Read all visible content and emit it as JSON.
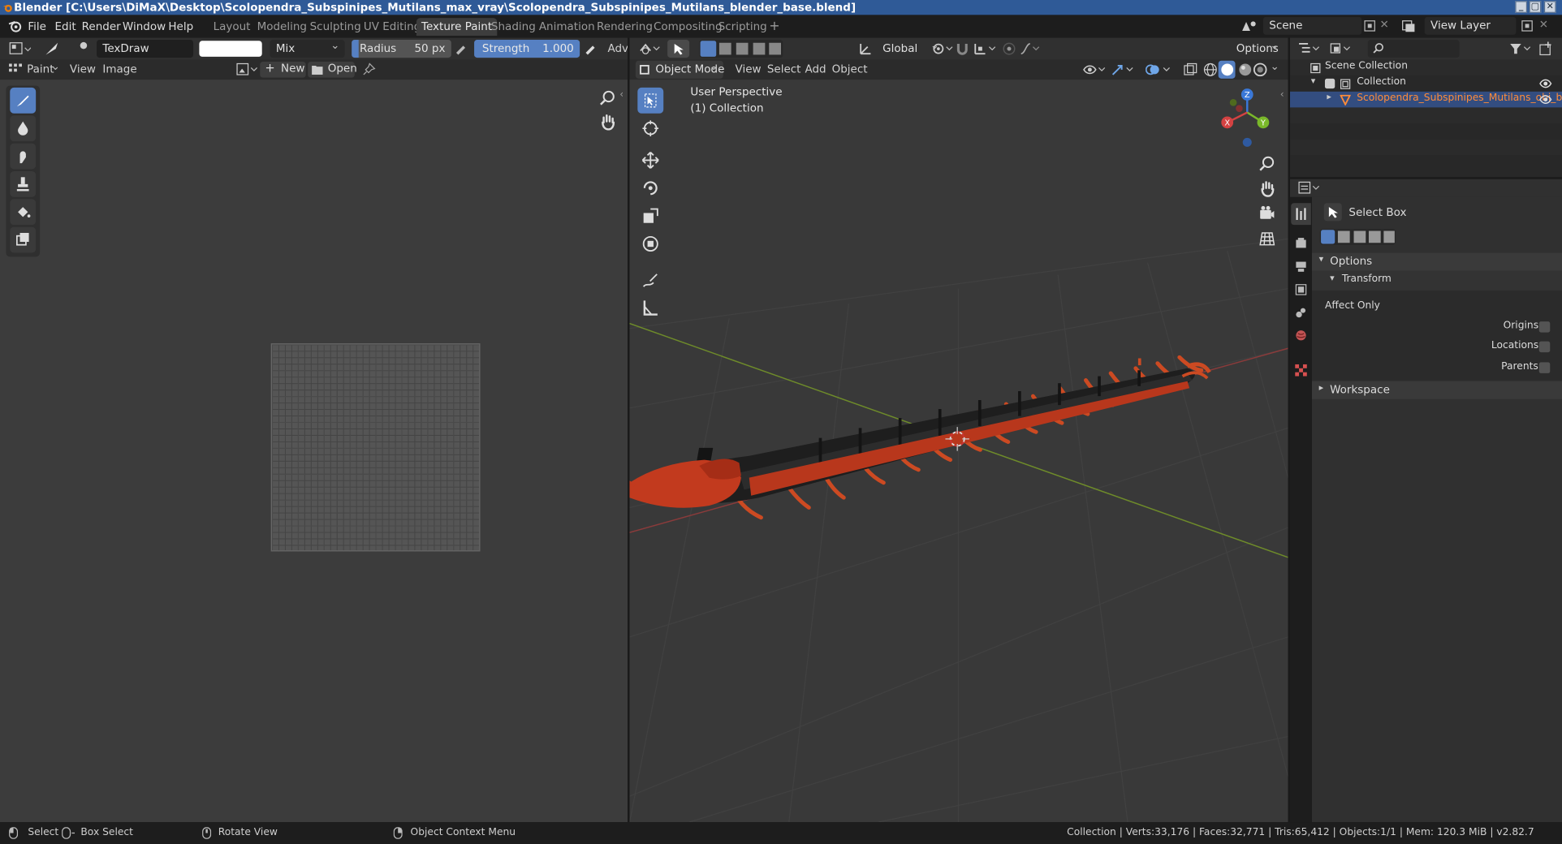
{
  "window": {
    "title": "Blender [C:\\Users\\DiMaX\\Desktop\\Scolopendra_Subspinipes_Mutilans_max_vray\\Scolopendra_Subspinipes_Mutilans_blender_base.blend]",
    "controls": [
      "_",
      "▢",
      "✕"
    ]
  },
  "menubar": {
    "items": [
      "File",
      "Edit",
      "Render",
      "Window",
      "Help"
    ]
  },
  "workspaces": {
    "tabs": [
      "Layout",
      "Modeling",
      "Sculpting",
      "UV Editing",
      "Texture Paint",
      "Shading",
      "Animation",
      "Rendering",
      "Compositing",
      "Scripting"
    ],
    "active": "Texture Paint",
    "add": "+"
  },
  "scene": {
    "name": "Scene"
  },
  "view_layer": {
    "name": "View Layer"
  },
  "paint_header": {
    "brush": "TexDraw",
    "blend": "Mix",
    "radius_label": "Radius",
    "radius_value": "50 px",
    "strength_label": "Strength",
    "strength_value": "1.000",
    "advanced": "Adva",
    "brush_color": "#ffffff"
  },
  "image_editor": {
    "mode": "Paint",
    "menus": [
      "View",
      "Image"
    ],
    "new_label": "New",
    "open_label": "Open"
  },
  "viewport": {
    "mode": "Object Mode",
    "menus": [
      "View",
      "Select",
      "Add",
      "Object"
    ],
    "orientation": "Global",
    "options": "Options",
    "overlay_line1": "User Perspective",
    "overlay_line2": "(1) Collection",
    "gizmo": {
      "z": "Z",
      "y": "Y",
      "x": "X"
    }
  },
  "outliner": {
    "root": "Scene Collection",
    "collection": "Collection",
    "object": "Scolopendra_Subspinipes_Mutilans_obj_base"
  },
  "properties": {
    "tool": "Select Box",
    "options_label": "Options",
    "transform_label": "Transform",
    "affect_only": "Affect Only",
    "origins": "Origins",
    "locations": "Locations",
    "parents": "Parents",
    "workspace_label": "Workspace"
  },
  "statusbar": {
    "select": "Select",
    "box_select": "Box Select",
    "rotate": "Rotate View",
    "context": "Object Context Menu",
    "stats": "Collection | Verts:33,176 | Faces:32,771 | Tris:65,412 | Objects:1/1 | Mem: 120.3 MiB | v2.82.7"
  },
  "colors": {
    "accent": "#5680c2",
    "active_text": "#ff8c3a",
    "body_red": "#c23a1e",
    "body_dark": "#202020"
  }
}
